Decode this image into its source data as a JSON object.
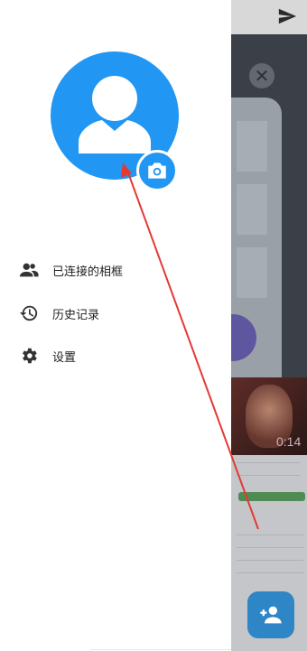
{
  "drawer": {
    "menu": [
      {
        "label": "已连接的相框",
        "icon": "people-icon"
      },
      {
        "label": "历史记录",
        "icon": "history-icon"
      },
      {
        "label": "设置",
        "icon": "gear-icon"
      }
    ]
  },
  "background": {
    "video_time": "0:14"
  },
  "colors": {
    "accent": "#2196f3",
    "arrow": "#e53935"
  }
}
